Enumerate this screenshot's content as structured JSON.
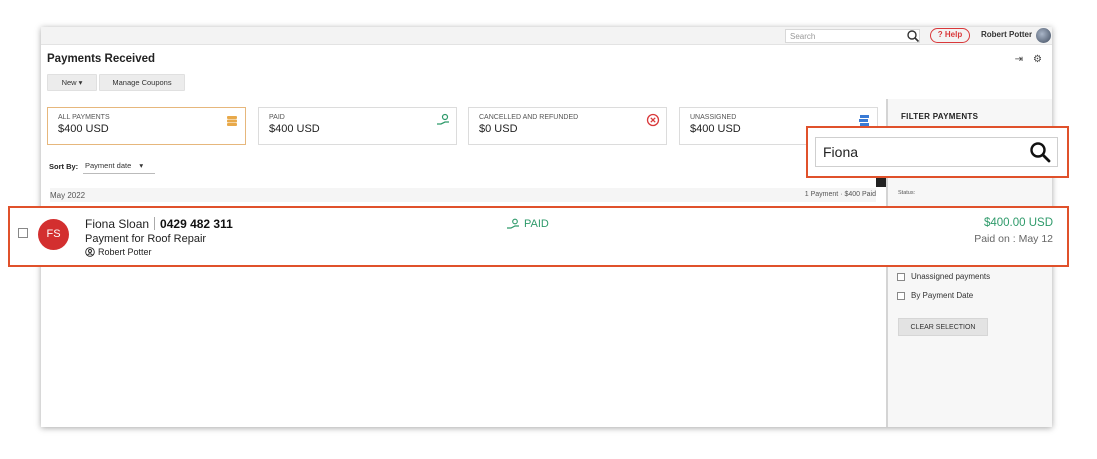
{
  "topbar": {
    "search_placeholder": "Search",
    "help_label": "? Help",
    "user_name": "Robert Potter"
  },
  "page": {
    "title": "Payments Received",
    "new_button": "New ▾",
    "manage_coupons_button": "Manage Coupons"
  },
  "summary_cards": [
    {
      "label": "ALL PAYMENTS",
      "value": "$400 USD",
      "icon": "coins-icon"
    },
    {
      "label": "PAID",
      "value": "$400 USD",
      "icon": "money-hand-icon"
    },
    {
      "label": "CANCELLED AND REFUNDED",
      "value": "$0 USD",
      "icon": "cancel-circle-icon"
    },
    {
      "label": "UNASSIGNED",
      "value": "$400 USD",
      "icon": "stack-icon"
    }
  ],
  "sort": {
    "label": "Sort By:",
    "selected": "Payment date"
  },
  "group": {
    "month": "May 2022",
    "summary": "1 Payment  ·  $400 Paid"
  },
  "filter_panel": {
    "title": "FILTER PAYMENTS",
    "search_value": "Fiona",
    "status_label": "Status:",
    "options": [
      "Unassigned payments",
      "By Payment Date"
    ],
    "clear_button": "CLEAR SELECTION"
  },
  "payment_row": {
    "initials": "FS",
    "name": "Fiona Sloan",
    "phone": "0429 482 311",
    "description": "Payment for Roof Repair",
    "owner": "Robert Potter",
    "status": "PAID",
    "amount": "$400.00 USD",
    "paid_on": "Paid on : May 12"
  },
  "colors": {
    "accent_red": "#e0512b",
    "paid_green": "#2e9a6a",
    "avatar_red": "#d32f2f"
  }
}
